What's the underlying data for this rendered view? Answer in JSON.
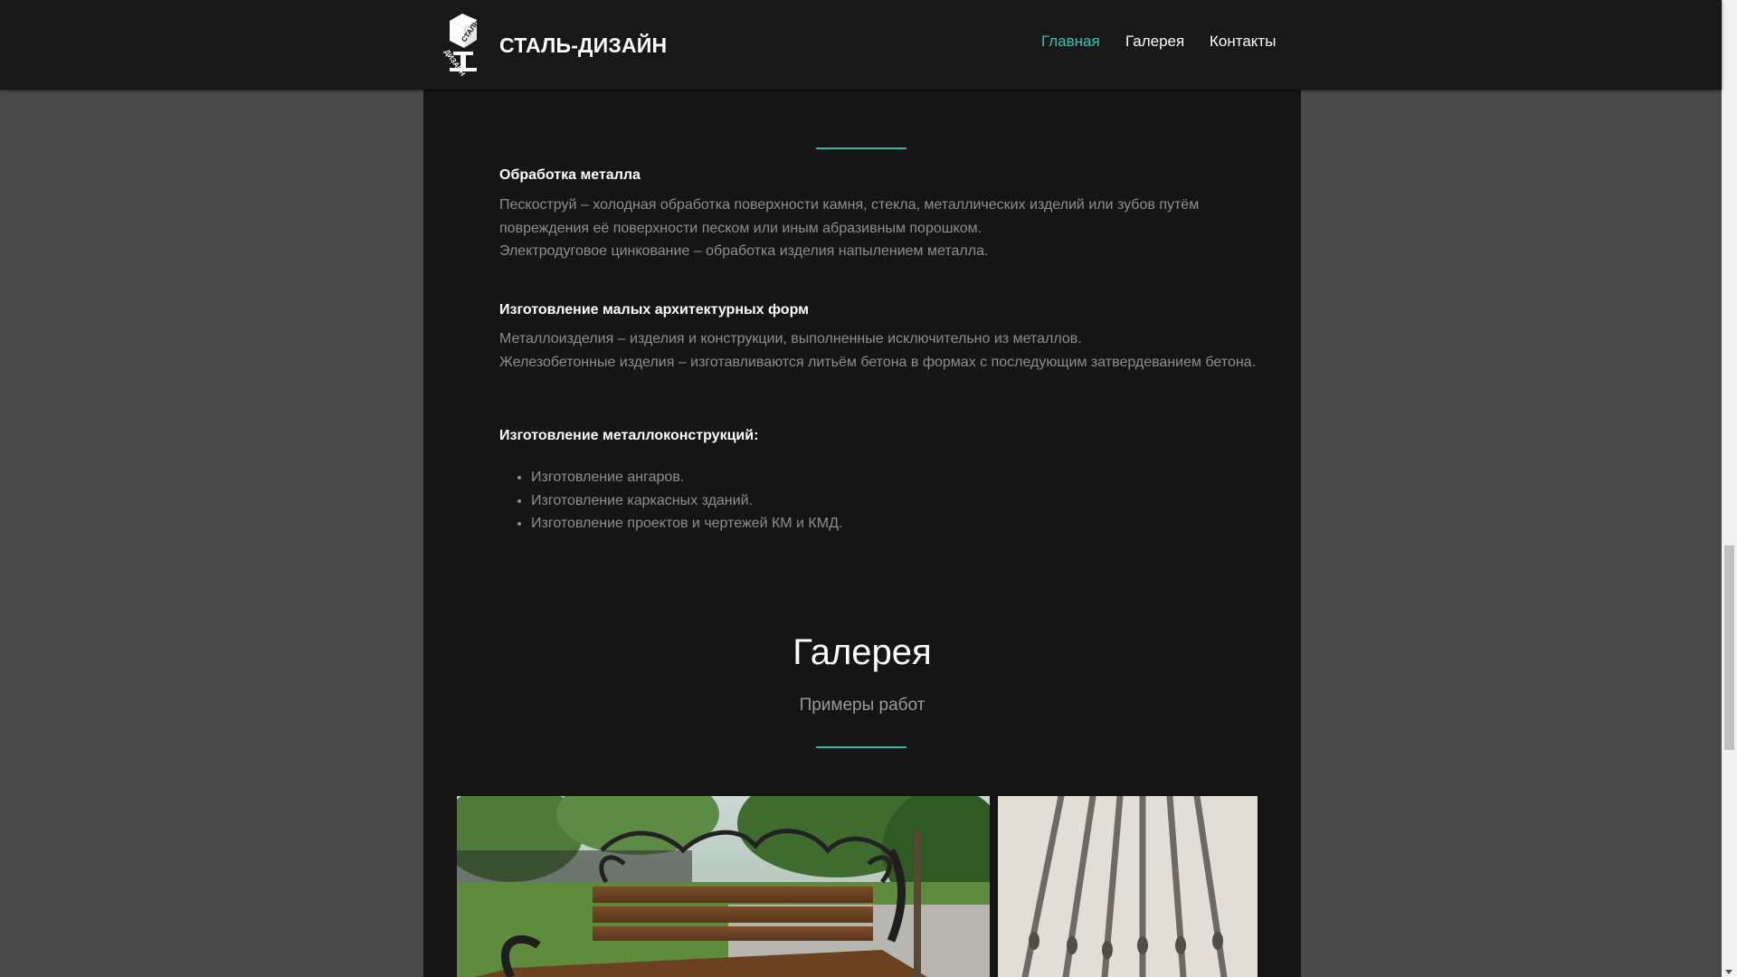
{
  "header": {
    "brand": "СТАЛЬ-ДИЗАЙН",
    "logo_text_top": "СТАЛЬ",
    "logo_text_bottom": "ДИЗАЙН",
    "nav": [
      {
        "label": "Главная",
        "active": true
      },
      {
        "label": "Галерея",
        "active": false
      },
      {
        "label": "Контакты",
        "active": false
      }
    ]
  },
  "sections": {
    "metal": {
      "title": "Обработка металла",
      "lines": [
        "Пескоструй – холодная обработка поверхности камня, стекла, металлических изделий или зубов путём",
        "повреждения её поверхности песком или иным абразивным порошком.",
        "Электродуговое цинкование – обработка изделия напылением металла."
      ]
    },
    "small_forms": {
      "title": "Изготовление малых архитектурных форм",
      "lines": [
        "Металлоизделия – изделия и конструкции, выполненные исключительно из металлов.",
        "Железобетонные изделия – изготавливаются литьём бетона в формах с последующим затвердеванием бетона."
      ]
    },
    "structures": {
      "title": "Изготовление металлоконструкций:",
      "items": [
        "Изготовление ангаров.",
        "Изготовление каркасных зданий.",
        "Изготовление проектов и чертежей КМ и КМД."
      ]
    }
  },
  "gallery": {
    "title": "Галерея",
    "subtitle": "Примеры работ",
    "photos": [
      {
        "subject": "forged-bench"
      },
      {
        "subject": "forged-skewers"
      }
    ]
  },
  "colors": {
    "accent": "#3ec0ad",
    "background": "#151515",
    "page_background": "#4a4a4a"
  }
}
